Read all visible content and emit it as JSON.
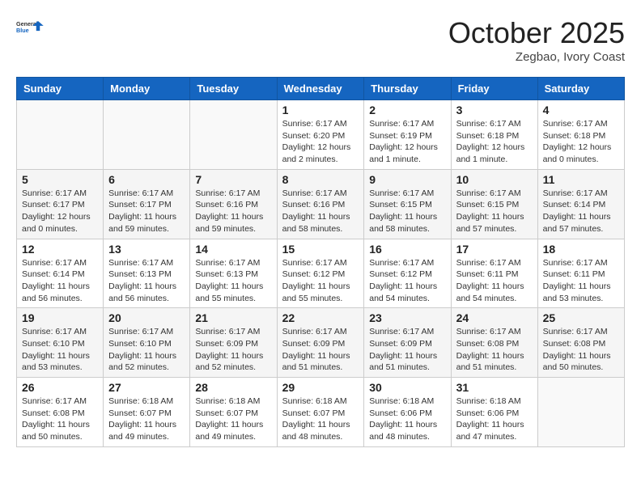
{
  "header": {
    "logo_line1": "General",
    "logo_line2": "Blue",
    "month": "October 2025",
    "location": "Zegbao, Ivory Coast"
  },
  "weekdays": [
    "Sunday",
    "Monday",
    "Tuesday",
    "Wednesday",
    "Thursday",
    "Friday",
    "Saturday"
  ],
  "weeks": [
    [
      {
        "day": "",
        "info": ""
      },
      {
        "day": "",
        "info": ""
      },
      {
        "day": "",
        "info": ""
      },
      {
        "day": "1",
        "info": "Sunrise: 6:17 AM\nSunset: 6:20 PM\nDaylight: 12 hours\nand 2 minutes."
      },
      {
        "day": "2",
        "info": "Sunrise: 6:17 AM\nSunset: 6:19 PM\nDaylight: 12 hours\nand 1 minute."
      },
      {
        "day": "3",
        "info": "Sunrise: 6:17 AM\nSunset: 6:18 PM\nDaylight: 12 hours\nand 1 minute."
      },
      {
        "day": "4",
        "info": "Sunrise: 6:17 AM\nSunset: 6:18 PM\nDaylight: 12 hours\nand 0 minutes."
      }
    ],
    [
      {
        "day": "5",
        "info": "Sunrise: 6:17 AM\nSunset: 6:17 PM\nDaylight: 12 hours\nand 0 minutes."
      },
      {
        "day": "6",
        "info": "Sunrise: 6:17 AM\nSunset: 6:17 PM\nDaylight: 11 hours\nand 59 minutes."
      },
      {
        "day": "7",
        "info": "Sunrise: 6:17 AM\nSunset: 6:16 PM\nDaylight: 11 hours\nand 59 minutes."
      },
      {
        "day": "8",
        "info": "Sunrise: 6:17 AM\nSunset: 6:16 PM\nDaylight: 11 hours\nand 58 minutes."
      },
      {
        "day": "9",
        "info": "Sunrise: 6:17 AM\nSunset: 6:15 PM\nDaylight: 11 hours\nand 58 minutes."
      },
      {
        "day": "10",
        "info": "Sunrise: 6:17 AM\nSunset: 6:15 PM\nDaylight: 11 hours\nand 57 minutes."
      },
      {
        "day": "11",
        "info": "Sunrise: 6:17 AM\nSunset: 6:14 PM\nDaylight: 11 hours\nand 57 minutes."
      }
    ],
    [
      {
        "day": "12",
        "info": "Sunrise: 6:17 AM\nSunset: 6:14 PM\nDaylight: 11 hours\nand 56 minutes."
      },
      {
        "day": "13",
        "info": "Sunrise: 6:17 AM\nSunset: 6:13 PM\nDaylight: 11 hours\nand 56 minutes."
      },
      {
        "day": "14",
        "info": "Sunrise: 6:17 AM\nSunset: 6:13 PM\nDaylight: 11 hours\nand 55 minutes."
      },
      {
        "day": "15",
        "info": "Sunrise: 6:17 AM\nSunset: 6:12 PM\nDaylight: 11 hours\nand 55 minutes."
      },
      {
        "day": "16",
        "info": "Sunrise: 6:17 AM\nSunset: 6:12 PM\nDaylight: 11 hours\nand 54 minutes."
      },
      {
        "day": "17",
        "info": "Sunrise: 6:17 AM\nSunset: 6:11 PM\nDaylight: 11 hours\nand 54 minutes."
      },
      {
        "day": "18",
        "info": "Sunrise: 6:17 AM\nSunset: 6:11 PM\nDaylight: 11 hours\nand 53 minutes."
      }
    ],
    [
      {
        "day": "19",
        "info": "Sunrise: 6:17 AM\nSunset: 6:10 PM\nDaylight: 11 hours\nand 53 minutes."
      },
      {
        "day": "20",
        "info": "Sunrise: 6:17 AM\nSunset: 6:10 PM\nDaylight: 11 hours\nand 52 minutes."
      },
      {
        "day": "21",
        "info": "Sunrise: 6:17 AM\nSunset: 6:09 PM\nDaylight: 11 hours\nand 52 minutes."
      },
      {
        "day": "22",
        "info": "Sunrise: 6:17 AM\nSunset: 6:09 PM\nDaylight: 11 hours\nand 51 minutes."
      },
      {
        "day": "23",
        "info": "Sunrise: 6:17 AM\nSunset: 6:09 PM\nDaylight: 11 hours\nand 51 minutes."
      },
      {
        "day": "24",
        "info": "Sunrise: 6:17 AM\nSunset: 6:08 PM\nDaylight: 11 hours\nand 51 minutes."
      },
      {
        "day": "25",
        "info": "Sunrise: 6:17 AM\nSunset: 6:08 PM\nDaylight: 11 hours\nand 50 minutes."
      }
    ],
    [
      {
        "day": "26",
        "info": "Sunrise: 6:17 AM\nSunset: 6:08 PM\nDaylight: 11 hours\nand 50 minutes."
      },
      {
        "day": "27",
        "info": "Sunrise: 6:18 AM\nSunset: 6:07 PM\nDaylight: 11 hours\nand 49 minutes."
      },
      {
        "day": "28",
        "info": "Sunrise: 6:18 AM\nSunset: 6:07 PM\nDaylight: 11 hours\nand 49 minutes."
      },
      {
        "day": "29",
        "info": "Sunrise: 6:18 AM\nSunset: 6:07 PM\nDaylight: 11 hours\nand 48 minutes."
      },
      {
        "day": "30",
        "info": "Sunrise: 6:18 AM\nSunset: 6:06 PM\nDaylight: 11 hours\nand 48 minutes."
      },
      {
        "day": "31",
        "info": "Sunrise: 6:18 AM\nSunset: 6:06 PM\nDaylight: 11 hours\nand 47 minutes."
      },
      {
        "day": "",
        "info": ""
      }
    ]
  ]
}
